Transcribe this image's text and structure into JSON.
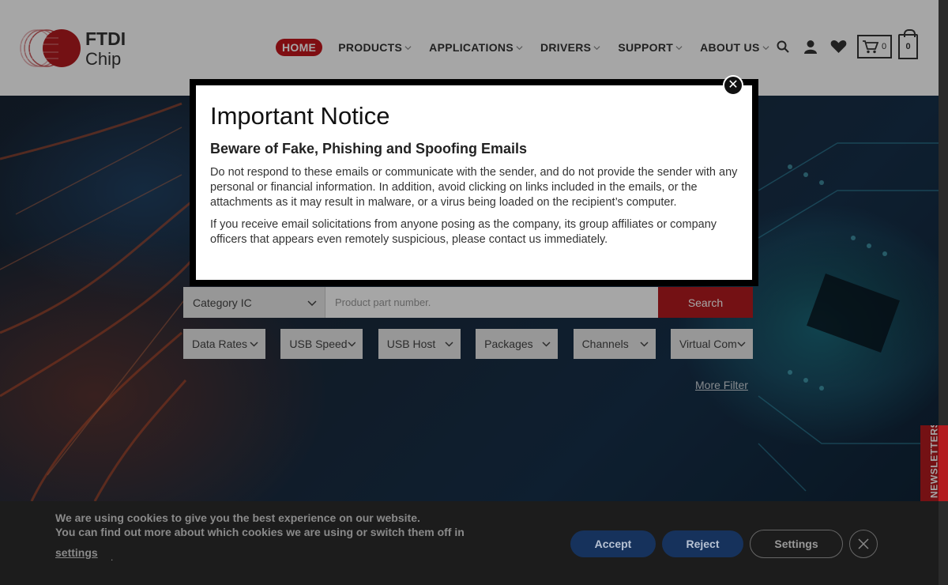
{
  "brand": {
    "logo_line1": "FTDI",
    "logo_line2": "Chip",
    "accent_color": "#c4161c"
  },
  "nav": {
    "items": [
      {
        "label": "HOME",
        "active": true,
        "has_dropdown": false
      },
      {
        "label": "PRODUCTS",
        "active": false,
        "has_dropdown": true
      },
      {
        "label": "APPLICATIONS",
        "active": false,
        "has_dropdown": true
      },
      {
        "label": "DRIVERS",
        "active": false,
        "has_dropdown": true
      },
      {
        "label": "SUPPORT",
        "active": false,
        "has_dropdown": true
      },
      {
        "label": "ABOUT US",
        "active": false,
        "has_dropdown": true
      }
    ]
  },
  "header_icons": {
    "search": "search-icon",
    "account": "user-icon",
    "wishlist": "heart-icon",
    "cart_count": "0",
    "bag_count": "0"
  },
  "search": {
    "category_value": "Category IC",
    "input_placeholder": "Product part number.",
    "button_label": "Search"
  },
  "filters": [
    {
      "label": "Data Rates"
    },
    {
      "label": "USB Speed"
    },
    {
      "label": "USB Host"
    },
    {
      "label": "Packages"
    },
    {
      "label": "Channels"
    },
    {
      "label": "Virtual Com"
    }
  ],
  "more_filter_label": "More Filter",
  "newsletter_tab": "NEWSLETTERS",
  "modal": {
    "title": "Important Notice",
    "subtitle": "Beware of Fake, Phishing and Spoofing Emails",
    "paragraph1": "Do not respond to these emails or communicate with the sender, and do not provide the sender with any personal or financial information. In addition, avoid clicking on links included in the emails, or the attachments as it may result in malware, or a virus being loaded on the recipient’s computer.",
    "paragraph2": "If you receive email solicitations from anyone posing as the company, its group affiliates or company officers that appears even remotely suspicious, please contact us immediately.",
    "close_glyph": "✕"
  },
  "cookie": {
    "line1": "We are using cookies to give you the best experience on our website.",
    "line2": "You can find out more about which cookies we are using or switch them off in",
    "settings_link": "settings",
    "accept_label": "Accept",
    "reject_label": "Reject",
    "settings_label": "Settings"
  }
}
